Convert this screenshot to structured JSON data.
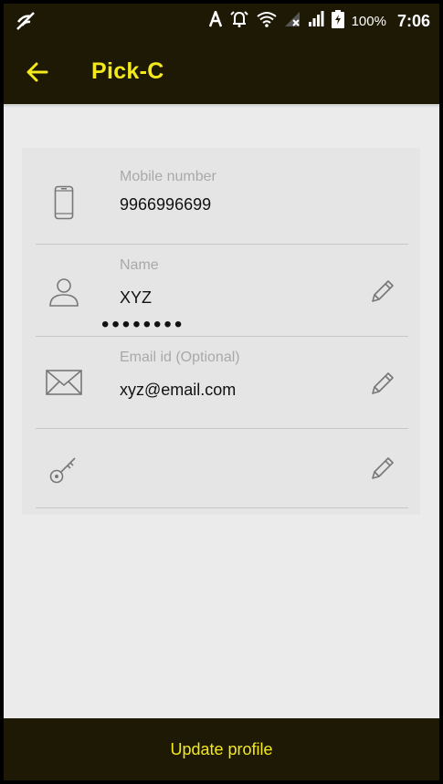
{
  "status_bar": {
    "battery": "100%",
    "time": "7:06"
  },
  "toolbar": {
    "title": "Pick-C"
  },
  "profile": {
    "mobile": {
      "label": "Mobile number",
      "value": "9966996699"
    },
    "name": {
      "label": "Name",
      "value": "XYZ"
    },
    "email": {
      "label": "Email id (Optional)",
      "value": "xyz@email.com"
    },
    "password": {
      "value": "••••••••"
    }
  },
  "footer": {
    "button_label": "Update profile"
  },
  "colors": {
    "bar_background": "#1e1904",
    "accent_yellow": "#f3e91d",
    "page_background": "#ebebeb"
  },
  "icons": [
    "no-signal-icon",
    "font-icon",
    "alarm-icon",
    "wifi-icon",
    "signal-icon",
    "battery-icon",
    "back-arrow-icon",
    "phone-icon",
    "person-icon",
    "mail-icon",
    "key-icon",
    "pencil-icon"
  ]
}
